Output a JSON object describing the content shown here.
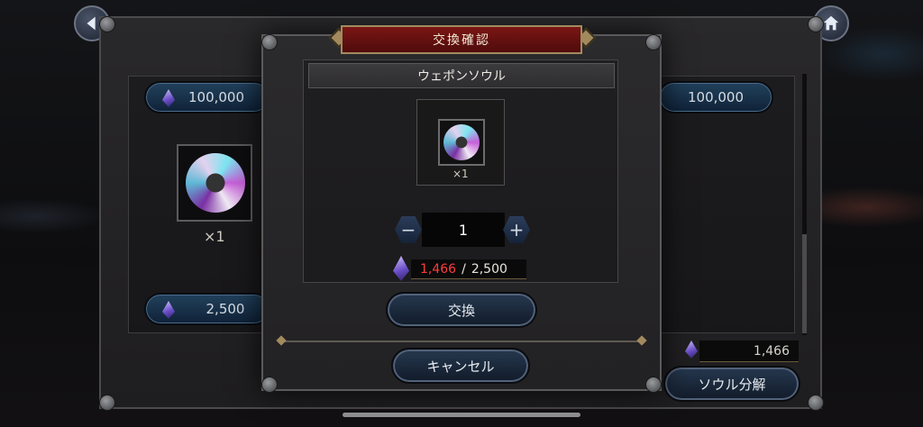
{
  "background_items": {
    "left_price": "100,000",
    "right_price": "100,000",
    "left_item_quantity": "×1",
    "left_bottom_price": "2,500",
    "balance": "1,466",
    "decompose_button": "ソウル分解"
  },
  "dialog": {
    "title": "交換確認",
    "item_name": "ウェポンソウル",
    "item_quantity": "×1",
    "quantity_value": "1",
    "minus_label": "−",
    "plus_label": "+",
    "cost_current": "1,466",
    "cost_separator": "/",
    "cost_total": "2,500",
    "exchange_button": "交換",
    "cancel_button": "キャンセル"
  },
  "colors": {
    "title_bar": "#7a1614",
    "insufficient_cost": "#ff3b3b",
    "price_button": "#22415c"
  }
}
